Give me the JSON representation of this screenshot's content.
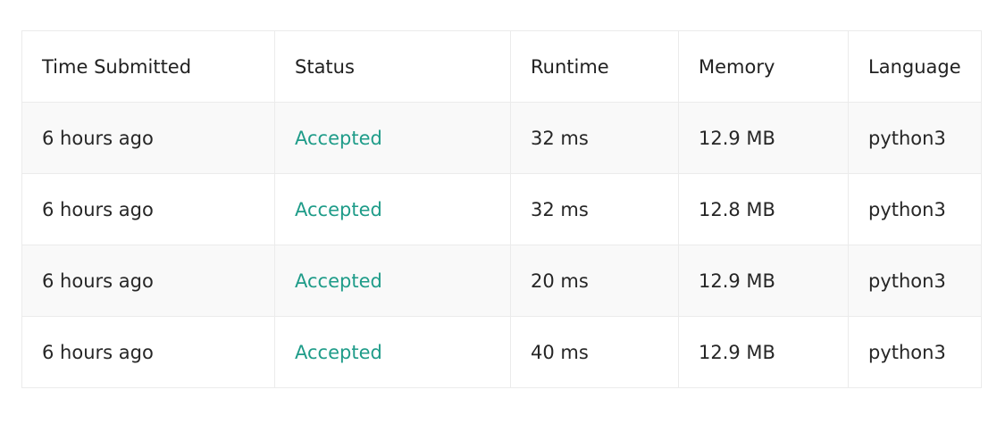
{
  "table": {
    "headers": {
      "time": "Time Submitted",
      "status": "Status",
      "runtime": "Runtime",
      "memory": "Memory",
      "language": "Language"
    },
    "rows": [
      {
        "time": "6 hours ago",
        "status": "Accepted",
        "runtime": "32 ms",
        "memory": "12.9 MB",
        "language": "python3"
      },
      {
        "time": "6 hours ago",
        "status": "Accepted",
        "runtime": "32 ms",
        "memory": "12.8 MB",
        "language": "python3"
      },
      {
        "time": "6 hours ago",
        "status": "Accepted",
        "runtime": "20 ms",
        "memory": "12.9 MB",
        "language": "python3"
      },
      {
        "time": "6 hours ago",
        "status": "Accepted",
        "runtime": "40 ms",
        "memory": "12.9 MB",
        "language": "python3"
      }
    ]
  },
  "colors": {
    "accepted": "#1f9c89",
    "row_stripe": "#f9f9f9",
    "border": "#ebebeb"
  }
}
